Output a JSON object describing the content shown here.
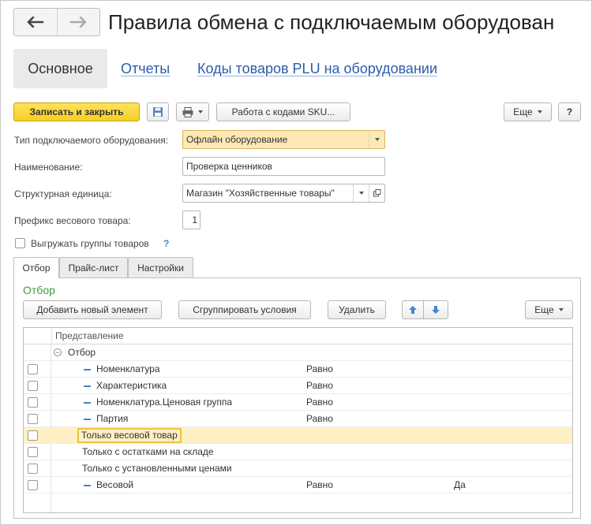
{
  "window": {
    "title": "Правила обмена с подключаемым оборудован"
  },
  "nav": {
    "back_icon": "arrow-left-icon",
    "forward_icon": "arrow-right-icon"
  },
  "sections": [
    {
      "label": "Основное",
      "active": true
    },
    {
      "label": "Отчеты",
      "active": false
    },
    {
      "label": "Коды товаров PLU на оборудовании",
      "active": false
    }
  ],
  "toolbar": {
    "save_close": "Записать и закрыть",
    "save_icon": "floppy-disk-icon",
    "print_icon": "printer-icon",
    "sku_codes": "Работа с кодами SKU...",
    "more": "Еще",
    "help": "?"
  },
  "form": {
    "equipment_type": {
      "label": "Тип подключаемого оборудования:",
      "value": "Офлайн оборудование"
    },
    "name": {
      "label": "Наименование:",
      "value": "Проверка ценников"
    },
    "unit": {
      "label": "Структурная единица:",
      "value": "Магазин \"Хозяйственные товары\""
    },
    "weight_prefix": {
      "label": "Префикс весового товара:",
      "value": "1"
    },
    "export_groups": {
      "label": "Выгружать группы товаров",
      "help": "?",
      "checked": false
    }
  },
  "tabs": [
    {
      "label": "Отбор",
      "active": true
    },
    {
      "label": "Прайс-лист",
      "active": false
    },
    {
      "label": "Настройки",
      "active": false
    }
  ],
  "filter": {
    "title": "Отбор",
    "add_new": "Добавить новый элемент",
    "group": "Сгруппировать условия",
    "delete": "Удалить",
    "more": "Еще",
    "column_header": "Представление",
    "rows": [
      {
        "kind": "group",
        "text": "Отбор",
        "condition": "",
        "value": ""
      },
      {
        "kind": "item",
        "text": "Номенклатура",
        "condition": "Равно",
        "value": ""
      },
      {
        "kind": "item",
        "text": "Характеристика",
        "condition": "Равно",
        "value": ""
      },
      {
        "kind": "item",
        "text": "Номенклатура.Ценовая группа",
        "condition": "Равно",
        "value": ""
      },
      {
        "kind": "item",
        "text": "Партия",
        "condition": "Равно",
        "value": ""
      },
      {
        "kind": "plain",
        "text": "Только весовой товар",
        "condition": "",
        "value": "",
        "selected": true
      },
      {
        "kind": "plain",
        "text": "Только с остатками на складе",
        "condition": "",
        "value": ""
      },
      {
        "kind": "plain",
        "text": "Только с установленными ценами",
        "condition": "",
        "value": ""
      },
      {
        "kind": "item",
        "text": "Весовой",
        "condition": "Равно",
        "value": "Да"
      }
    ]
  },
  "colors": {
    "accent_yellow": "#f5cf26",
    "link_blue": "#2a5ea8",
    "group_green": "#3aa03a",
    "selected_row": "#fdf0c4"
  }
}
